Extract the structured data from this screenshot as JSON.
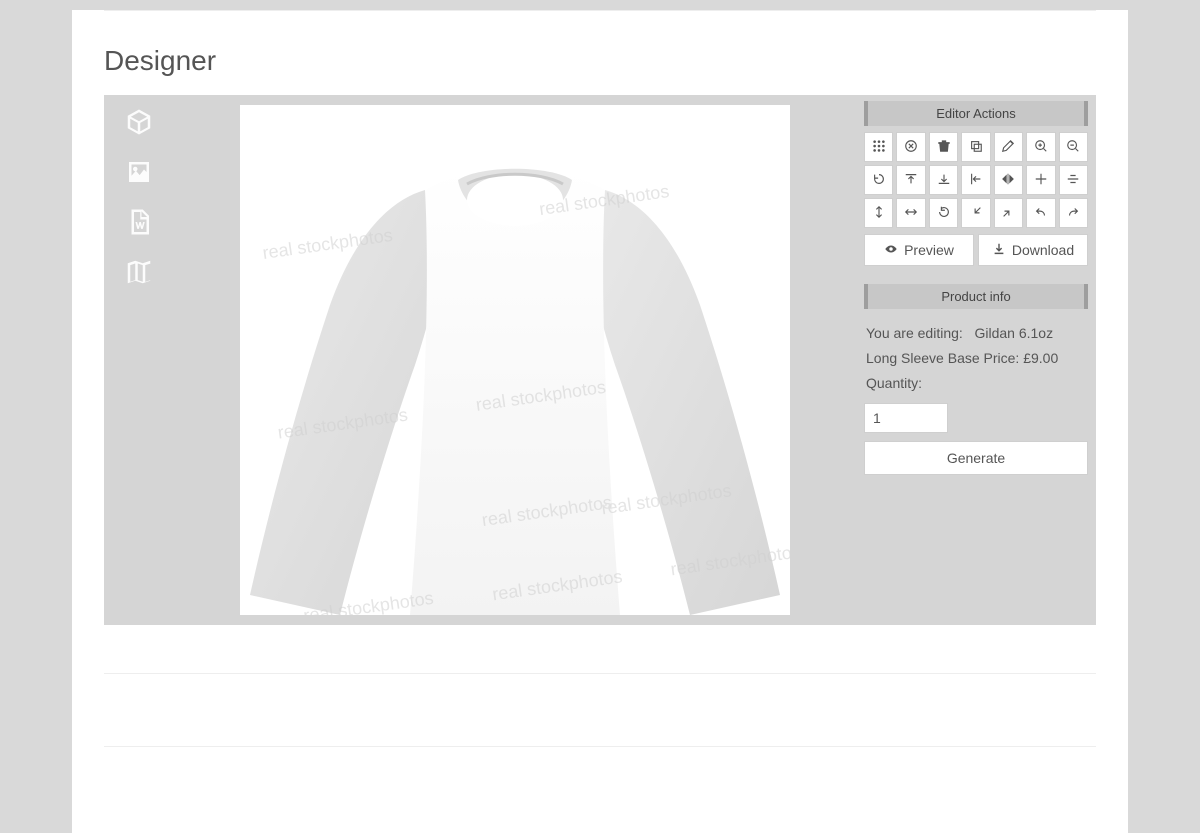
{
  "page": {
    "heading": "Designer"
  },
  "left_tools": {
    "product": "product-icon",
    "image": "image-icon",
    "text": "text-icon",
    "clipart": "clipart-icon"
  },
  "editor_actions": {
    "title": "Editor Actions",
    "buttons": {
      "grid": "grid",
      "clear": "clear",
      "delete": "delete",
      "copy": "copy",
      "edit": "edit",
      "zoom_in": "zoom-in",
      "zoom_out": "zoom-out",
      "rotate": "rotate",
      "align_top": "align-top",
      "align_bottom": "align-bottom",
      "align_left": "align-left",
      "flip_h": "flip-h",
      "center_h": "center-h",
      "center_v": "center-v",
      "height": "height",
      "width": "width",
      "reset": "reset",
      "scale_down": "scale-down",
      "scale_up": "scale-up",
      "undo": "undo",
      "redo": "redo"
    },
    "preview": "Preview",
    "download": "Download"
  },
  "product_info": {
    "title": "Product info",
    "editing_label": "You are editing:",
    "product_name": "Gildan 6.1oz Long Sleeve",
    "base_price_label": "Base Price:",
    "base_price": "£9.00",
    "quantity_label": "Quantity:",
    "quantity": "1",
    "generate": "Generate"
  }
}
